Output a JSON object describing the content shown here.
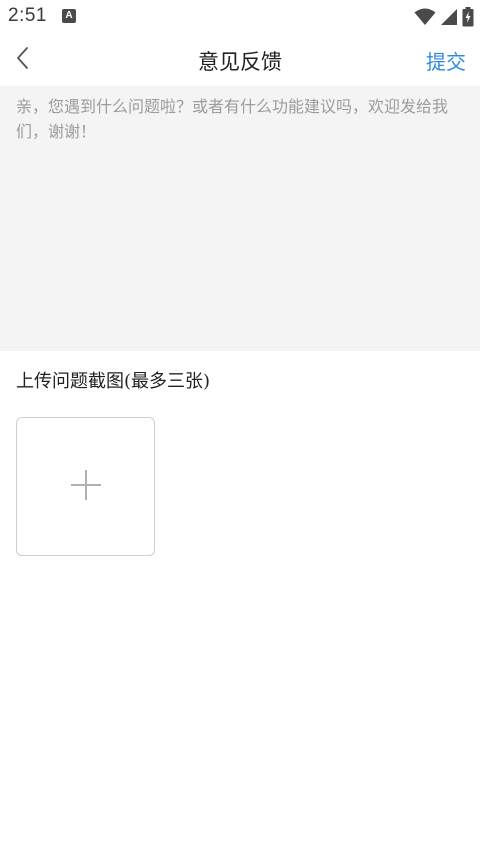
{
  "status_bar": {
    "time": "2:51",
    "notification_badge": "A",
    "icons": [
      "wifi-icon",
      "cellular-signal-icon",
      "battery-charging-icon"
    ]
  },
  "nav": {
    "back_icon": "chevron-left-icon",
    "title": "意见反馈",
    "submit_label": "提交"
  },
  "feedback": {
    "placeholder": "亲，您遇到什么问题啦？或者有什么功能建议吗，欢迎发给我们，谢谢！",
    "value": ""
  },
  "upload": {
    "label": "上传问题截图(最多三张)",
    "add_icon": "plus-icon"
  },
  "colors": {
    "accent": "#2f8ae0",
    "input_background": "#f4f4f4",
    "placeholder": "#9c9c9c",
    "border": "#cfcfcf"
  }
}
